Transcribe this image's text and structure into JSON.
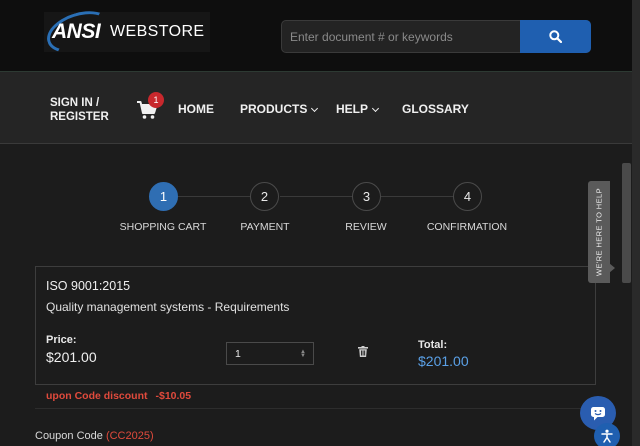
{
  "header": {
    "logo_brand": "ANSI",
    "logo_store": "WEBSTORE",
    "search_placeholder": "Enter document # or keywords"
  },
  "nav": {
    "signin_line1": "SIGN IN /",
    "signin_line2": "REGISTER",
    "cart_count": "1",
    "items": [
      {
        "label": "HOME"
      },
      {
        "label": "PRODUCTS"
      },
      {
        "label": "HELP"
      },
      {
        "label": "GLOSSARY"
      }
    ]
  },
  "steps": [
    {
      "number": "1",
      "label": "SHOPPING CART",
      "active": true
    },
    {
      "number": "2",
      "label": "PAYMENT",
      "active": false
    },
    {
      "number": "3",
      "label": "REVIEW",
      "active": false
    },
    {
      "number": "4",
      "label": "CONFIRMATION",
      "active": false
    }
  ],
  "cart_item": {
    "title": "ISO 9001:2015",
    "description": "Quality management systems - Requirements",
    "price_label": "Price:",
    "price": "$201.00",
    "quantity": "1",
    "total_label": "Total:",
    "total": "$201.00"
  },
  "coupon": {
    "discount_label": "upon Code discount",
    "discount_amount": "-$10.05",
    "code_label": "Coupon Code",
    "code_value": "(CC2025)"
  },
  "help_tab": {
    "label": "WE'RE HERE TO HELP"
  },
  "colors": {
    "accent_blue": "#2f6eb3",
    "discount_red": "#e04a3c",
    "badge_red": "#c8282d",
    "total_blue": "#5aa0e6"
  },
  "icons": {
    "search": "search-icon",
    "cart": "cart-icon",
    "trash": "trash-icon",
    "chat": "chat-icon",
    "accessibility": "accessibility-icon"
  }
}
